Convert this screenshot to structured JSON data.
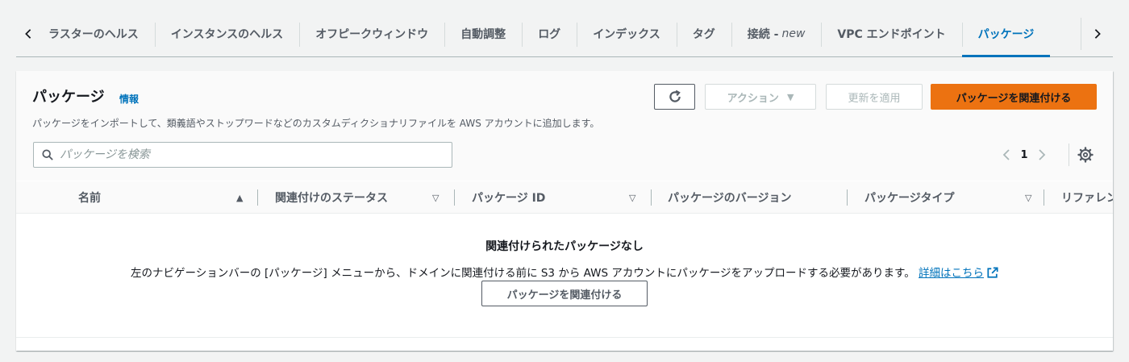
{
  "tabs": {
    "items": [
      {
        "label": "ラスターのヘルス"
      },
      {
        "label": "インスタンスのヘルス"
      },
      {
        "label": "オフピークウィンドウ"
      },
      {
        "label": "自動調整"
      },
      {
        "label": "ログ"
      },
      {
        "label": "インデックス"
      },
      {
        "label": "タグ"
      },
      {
        "label": "接続 -",
        "badge": "new"
      },
      {
        "label": "VPC エンドポイント"
      },
      {
        "label": "パッケージ",
        "active": true
      }
    ]
  },
  "panel": {
    "title": "パッケージ",
    "info": "情報",
    "description": "パッケージをインポートして、類義語やストップワードなどのカスタムディクショナリファイルを AWS アカウントに追加します。",
    "actions_label": "アクション",
    "apply_label": "更新を適用",
    "associate_label": "パッケージを関連付ける"
  },
  "search": {
    "placeholder": "パッケージを検索"
  },
  "pagination": {
    "current_page": "1"
  },
  "table": {
    "columns": [
      {
        "label": "名前",
        "sort": "ascending"
      },
      {
        "label": "関連付けのステータス",
        "sort": "sortable"
      },
      {
        "label": "パッケージ ID",
        "sort": "sortable"
      },
      {
        "label": "パッケージのバージョン",
        "sort": "none"
      },
      {
        "label": "パッケージタイプ",
        "sort": "sortable"
      },
      {
        "label": "リファレン",
        "sort": "none"
      }
    ]
  },
  "empty_state": {
    "title": "関連付けられたパッケージなし",
    "description": "左のナビゲーションバーの [パッケージ] メニューから、ドメインに関連付ける前に S3 から AWS アカウントにパッケージをアップロードする必要があります。",
    "learn_more": "詳細はこちら",
    "button_label": "パッケージを関連付ける"
  },
  "colors": {
    "primary": "#ec7211",
    "link": "#0073bb",
    "text": "#16191f",
    "muted": "#545b64"
  }
}
